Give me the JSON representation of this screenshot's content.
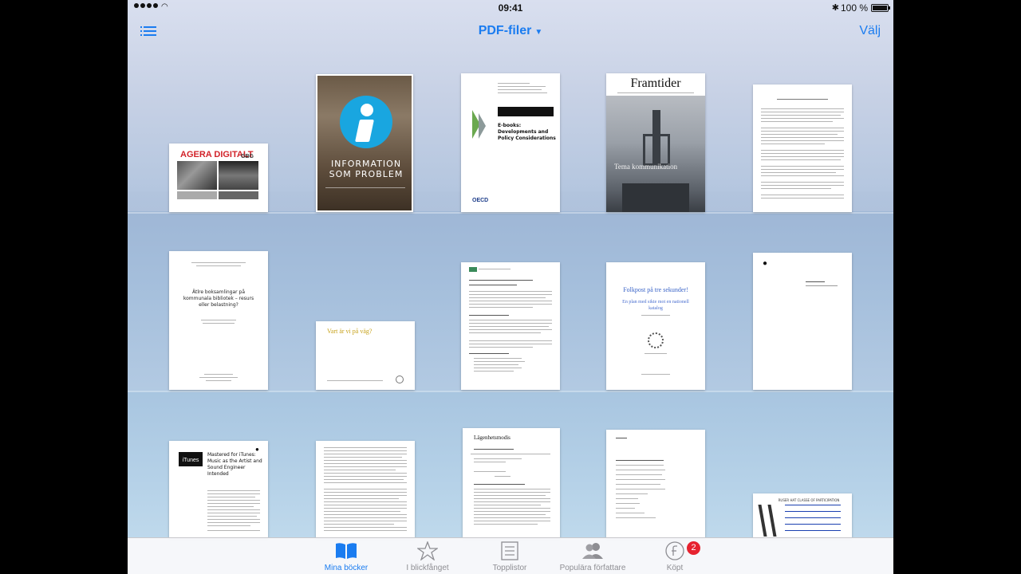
{
  "status": {
    "time": "09:41",
    "battery": "100 %"
  },
  "nav": {
    "title": "PDF-filer",
    "select_label": "Välj"
  },
  "books": {
    "agera": {
      "title_a": "AGERA DIGITALT",
      "title_b": "GBG"
    },
    "info": {
      "title": "INFORMATION SOM PROBLEM"
    },
    "oecd": {
      "title": "E-books: Developments and Policy Considerations",
      "publisher": "OECD"
    },
    "framtider": {
      "title": "Framtider",
      "subtitle": "Tema kommunikation"
    },
    "atle": {
      "title": "Ätlre boksamlingar på kommunala bibliotek – resurs eller belastning?"
    },
    "var": {
      "title": "Vart är vi på väg?"
    },
    "folkpost": {
      "title": "Folkpost på tre sekunder!",
      "subtitle": "En plan med sikte mot en nationell katalog"
    },
    "itunes": {
      "logo": "iTunes",
      "title": "Mastered for iTunes: Music as the Artist and Sound Engineer Intended"
    },
    "lagenhet": {
      "title": "Lägenhetsmodis"
    },
    "ruser": {
      "title": "RUSER HAT CLASSE OF PARTICIPATION"
    }
  },
  "tabs": [
    {
      "label": "Mina böcker",
      "icon": "books-icon",
      "active": true
    },
    {
      "label": "I blickfånget",
      "icon": "star-icon",
      "active": false
    },
    {
      "label": "Topplistor",
      "icon": "list-icon",
      "active": false
    },
    {
      "label": "Populära författare",
      "icon": "people-icon",
      "active": false
    },
    {
      "label": "Köpt",
      "icon": "purchased-icon",
      "active": false,
      "badge": "2"
    }
  ],
  "colors": {
    "accent": "#1a7cf0",
    "badge": "#e6222f",
    "info_circle": "#19a6e0"
  }
}
